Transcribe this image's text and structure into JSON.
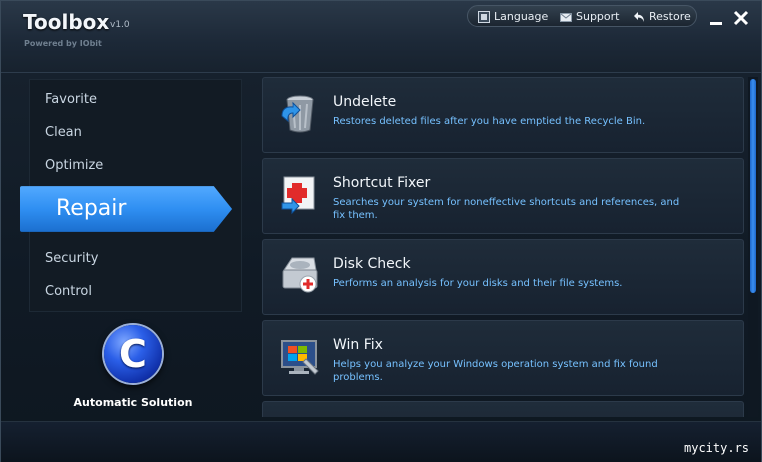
{
  "app": {
    "title": "Toolbox",
    "version": "v1.0",
    "subtitle": "Powered by IObit"
  },
  "topbar": {
    "language": "Language",
    "support": "Support",
    "restore": "Restore"
  },
  "window_controls": {
    "minimize": "—",
    "close": "✕"
  },
  "nav": {
    "items": [
      "Favorite",
      "Clean",
      "Optimize",
      "Repair",
      "Security",
      "Control"
    ],
    "active": "Repair"
  },
  "auto": {
    "glyph": "C",
    "label": "Automatic Solution"
  },
  "tools": [
    {
      "title": "Undelete",
      "desc": "Restores deleted files after you have emptied the Recycle Bin.",
      "icon": "recycle-bin-icon"
    },
    {
      "title": "Shortcut Fixer",
      "desc": "Searches your system for noneffective shortcuts and references, and fix them.",
      "icon": "shortcut-fixer-icon"
    },
    {
      "title": "Disk Check",
      "desc": "Performs an analysis for your disks and their file systems.",
      "icon": "disk-check-icon"
    },
    {
      "title": "Win Fix",
      "desc": "Helps you analyze your Windows operation system and fix found problems.",
      "icon": "win-fix-icon"
    }
  ],
  "watermark": "mycity.rs",
  "colors": {
    "accent": "#2a8ff0",
    "desc_text": "#76c1ff"
  }
}
